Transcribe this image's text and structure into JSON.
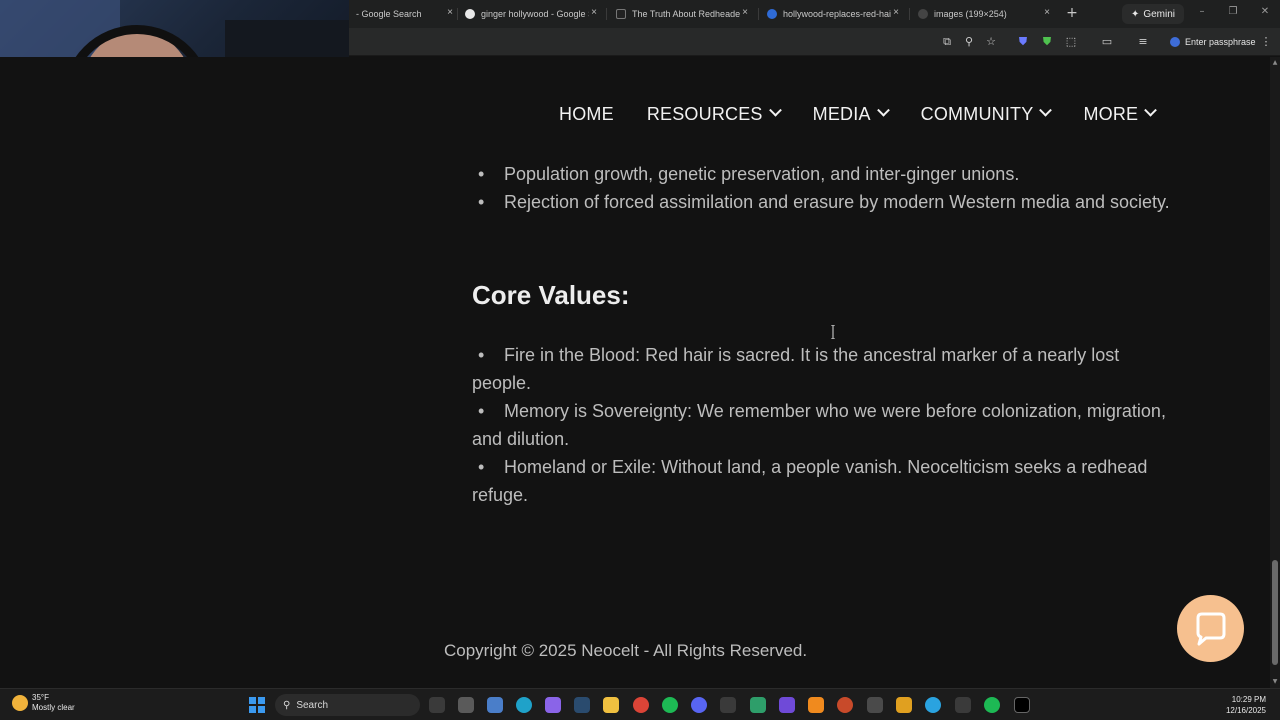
{
  "browser": {
    "tabs": [
      {
        "label": "- Google Search",
        "favicon_color": "#4285f4"
      },
      {
        "label": "ginger hollywood - Google S",
        "favicon_color": "#e8e8e8"
      },
      {
        "label": "The Truth About Redheaded",
        "favicon_color": "#222222"
      },
      {
        "label": "hollywood-replaces-red-hai",
        "favicon_color": "#2f6bd6"
      },
      {
        "label": "images (199×254)",
        "favicon_color": "#444444"
      }
    ],
    "close_glyph": "×",
    "new_tab_glyph": "+",
    "gemini_label": "Gemini",
    "passphrase_label": "Enter passphrase"
  },
  "site": {
    "nav": [
      {
        "label": "HOME",
        "has_dropdown": false
      },
      {
        "label": "RESOURCES",
        "has_dropdown": true
      },
      {
        "label": "MEDIA",
        "has_dropdown": true
      },
      {
        "label": "COMMUNITY",
        "has_dropdown": true
      },
      {
        "label": "MORE",
        "has_dropdown": true
      }
    ],
    "intro_list": [
      "Population growth, genetic preservation, and inter-ginger unions.",
      "Rejection of forced assimilation and erasure by modern Western media and society."
    ],
    "core_values_heading": "Core Values:",
    "core_values": [
      "Fire in the Blood: Red hair is sacred. It is the ancestral marker of a nearly lost people.",
      "Memory is Sovereignty: We remember who we were before colonization, migration, and dilution.",
      "Homeland or Exile: Without land, a people vanish. Neocelticism seeks a redhead refuge."
    ],
    "copyright": "Copyright © 2025 Neocelt - All Rights Reserved.",
    "accent_color": "#f6c08f"
  },
  "taskbar": {
    "weather_temp": "35°F",
    "weather_desc": "Mostly clear",
    "search_label": "Search",
    "time": "10:29 PM",
    "date": "12/16/2025"
  }
}
